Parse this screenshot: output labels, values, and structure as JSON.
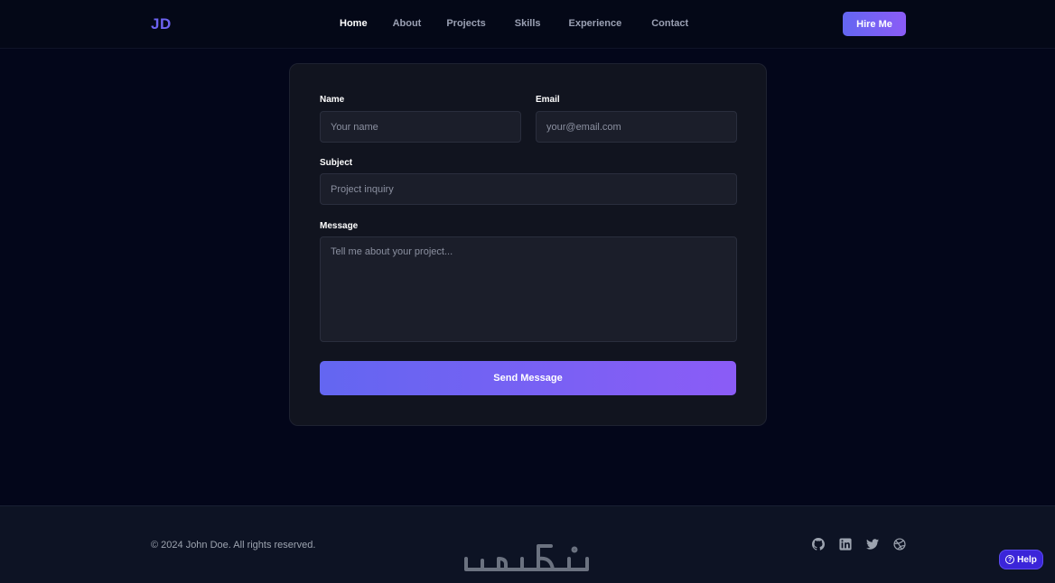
{
  "nav": {
    "logo": "JD",
    "links": [
      {
        "label": "Home",
        "active": true
      },
      {
        "label": "About",
        "active": false
      },
      {
        "label": "Projects",
        "active": false
      },
      {
        "label": "Skills",
        "active": false
      },
      {
        "label": "Experience",
        "active": false
      },
      {
        "label": "Contact",
        "active": false
      }
    ],
    "cta": "Hire Me"
  },
  "form": {
    "name": {
      "label": "Name",
      "placeholder": "Your name"
    },
    "email": {
      "label": "Email",
      "placeholder": "your@email.com"
    },
    "subject": {
      "label": "Subject",
      "placeholder": "Project inquiry"
    },
    "message": {
      "label": "Message",
      "placeholder": "Tell me about your project..."
    },
    "submit": "Send Message"
  },
  "footer": {
    "copyright": "© 2024 John Doe. All rights reserved.",
    "watermark": "خمسات",
    "social_icons": [
      "github-icon",
      "linkedin-icon",
      "twitter-icon",
      "dribbble-icon"
    ]
  },
  "help": {
    "label": "Help",
    "glyph": "?"
  },
  "colors": {
    "background": "#03061a",
    "accent_start": "#6366f1",
    "accent_end": "#8b5cf6",
    "card": "#11141f",
    "input": "#1b1e2a",
    "footer": "#0d1324"
  }
}
